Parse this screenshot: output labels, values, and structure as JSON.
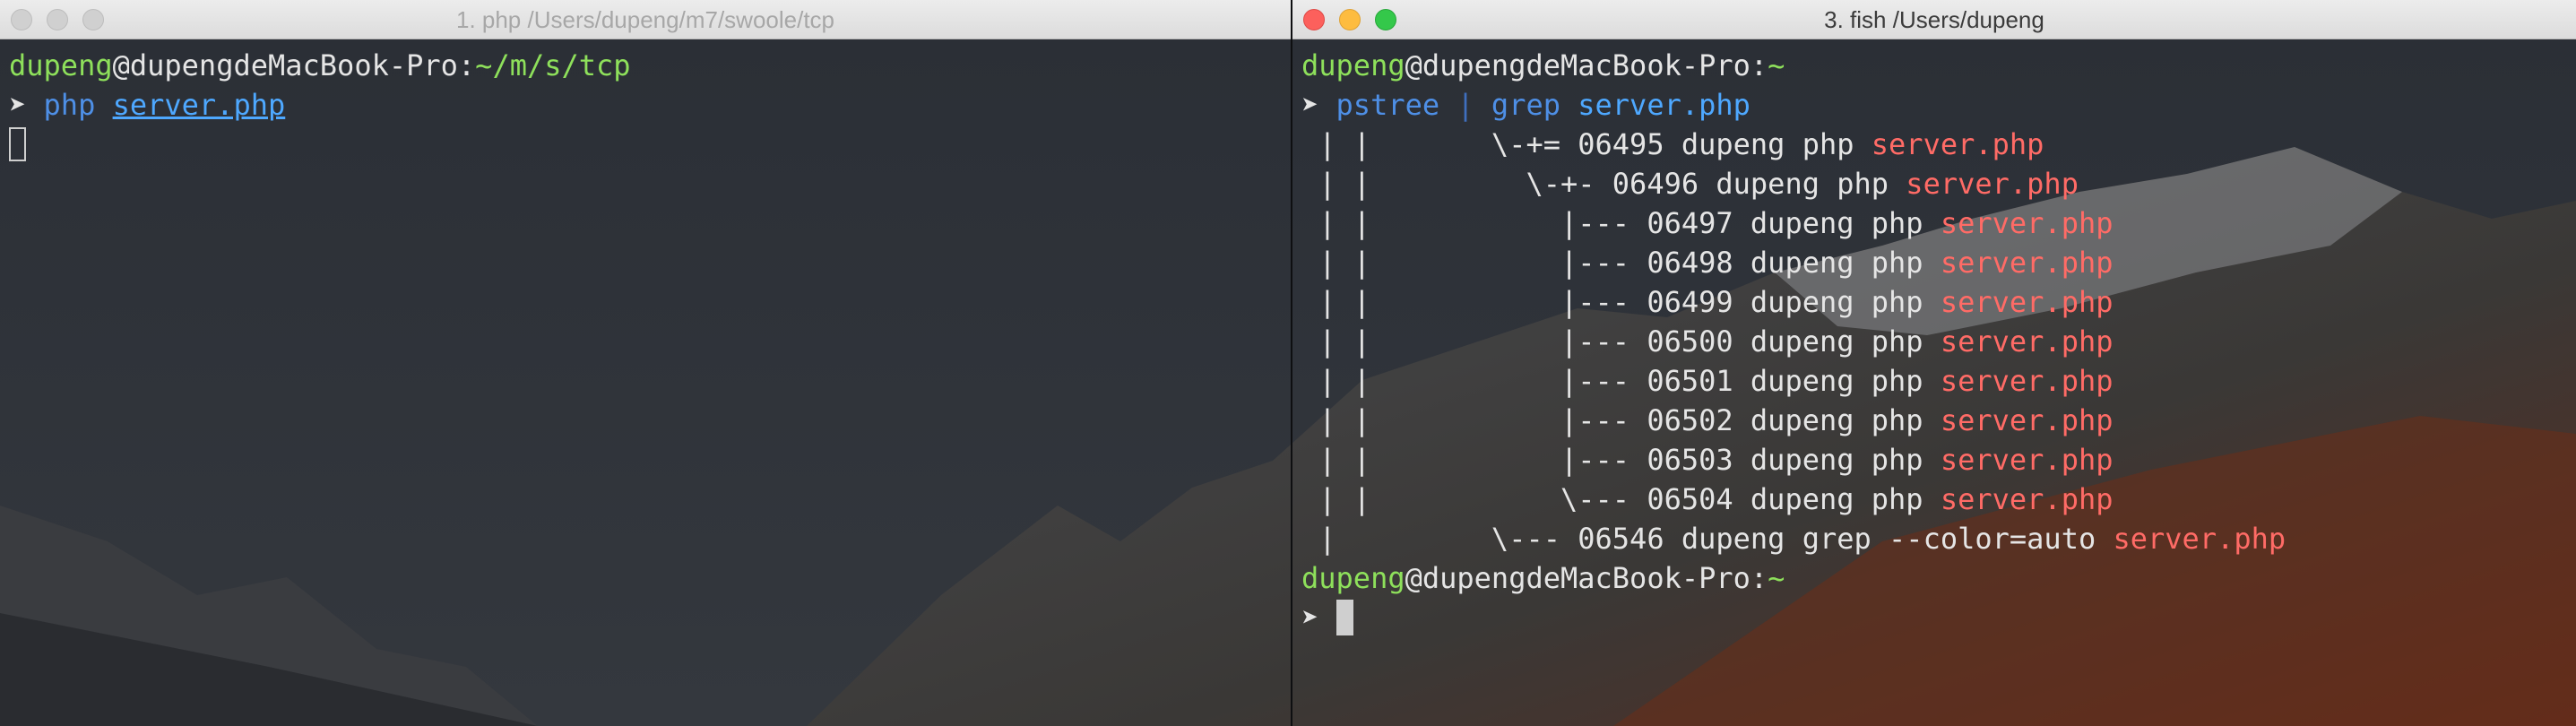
{
  "left_window": {
    "title": "1. php /Users/dupeng/m7/swoole/tcp",
    "prompt": {
      "user": "dupeng",
      "at": "@",
      "host": "dupengdeMacBook-Pro",
      "sep": ":",
      "cwd": "~/m/s/tcp"
    },
    "command": {
      "arrow": "➤",
      "cmd": "php",
      "arg": "server.php"
    }
  },
  "right_window": {
    "title": "3. fish /Users/dupeng",
    "prompt": {
      "user": "dupeng",
      "at": "@",
      "host": "dupengdeMacBook-Pro",
      "sep": ":",
      "cwd": "~"
    },
    "command": {
      "arrow": "➤",
      "cmd": "pstree",
      "pipe": "|",
      "cmd2": "grep",
      "arg": "server.php"
    },
    "output": [
      {
        "prefix": " | |       \\-+= 06495 dupeng php ",
        "match": "server.php"
      },
      {
        "prefix": " | |         \\-+- 06496 dupeng php ",
        "match": "server.php"
      },
      {
        "prefix": " | |           |--- 06497 dupeng php ",
        "match": "server.php"
      },
      {
        "prefix": " | |           |--- 06498 dupeng php ",
        "match": "server.php"
      },
      {
        "prefix": " | |           |--- 06499 dupeng php ",
        "match": "server.php"
      },
      {
        "prefix": " | |           |--- 06500 dupeng php ",
        "match": "server.php"
      },
      {
        "prefix": " | |           |--- 06501 dupeng php ",
        "match": "server.php"
      },
      {
        "prefix": " | |           |--- 06502 dupeng php ",
        "match": "server.php"
      },
      {
        "prefix": " | |           |--- 06503 dupeng php ",
        "match": "server.php"
      },
      {
        "prefix": " | |           \\--- 06504 dupeng php ",
        "match": "server.php"
      },
      {
        "prefix": " |         \\--- 06546 dupeng grep --color=auto ",
        "match": "server.php"
      }
    ],
    "prompt2": {
      "user": "dupeng",
      "at": "@",
      "host": "dupengdeMacBook-Pro",
      "sep": ":",
      "cwd": "~"
    },
    "prompt2_arrow": "➤"
  },
  "colors": {
    "prompt_user": "#8ee05b",
    "command": "#4e8fe6",
    "argument": "#4ea8ff",
    "grep_match": "#ff6b66",
    "close": "#fc605c",
    "minimize": "#fdbc40",
    "zoom": "#34c84a"
  }
}
